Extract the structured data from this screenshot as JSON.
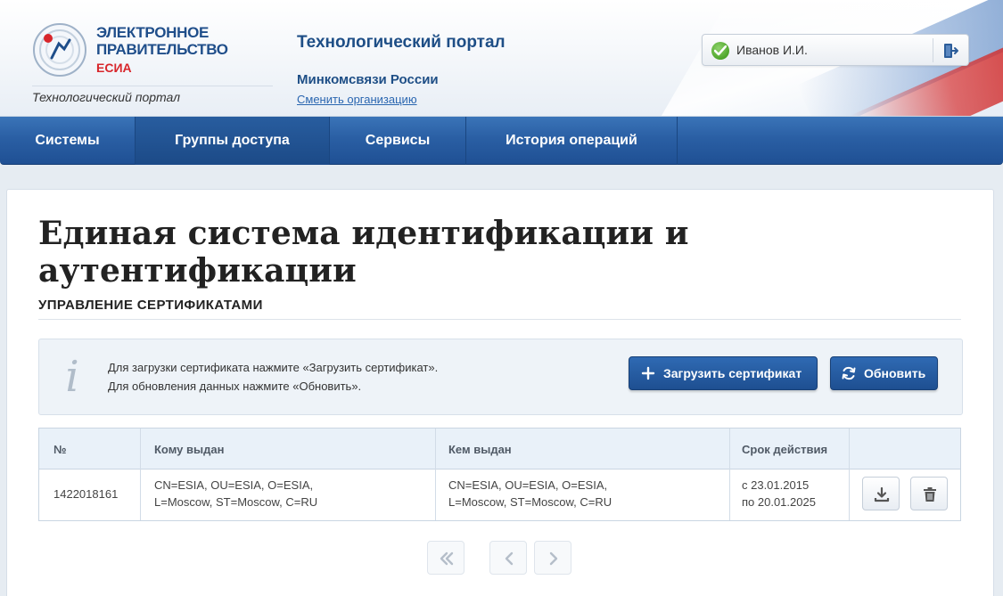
{
  "header": {
    "logo": {
      "line1": "ЭЛЕКТРОННОЕ",
      "line2": "ПРАВИТЕЛЬСТВО",
      "line3": "ЕСИА",
      "subtitle": "Технологический портал"
    },
    "portal_title": "Технологический портал",
    "organization": "Минкомсвязи России",
    "change_org_link": "Сменить организацию",
    "user": {
      "name": "Иванов И.И.",
      "status_icon": "check-icon",
      "logout_icon": "logout-icon"
    }
  },
  "nav": {
    "items": [
      {
        "label": "Системы",
        "active": false
      },
      {
        "label": "Группы доступа",
        "active": true
      },
      {
        "label": "Сервисы",
        "active": false
      },
      {
        "label": "История операций",
        "active": false
      }
    ]
  },
  "main": {
    "title": "Единая система идентификации и аутентификации",
    "section_title": "УПРАВЛЕНИЕ СЕРТИФИКАТАМИ",
    "info": {
      "icon": "info-icon",
      "line1": "Для загрузки сертификата нажмите «Загрузить сертификат».",
      "line2": "Для обновления данных нажмите «Обновить»."
    },
    "buttons": {
      "upload": "Загрузить сертификат",
      "refresh": "Обновить"
    },
    "table": {
      "headers": [
        "№",
        "Кому выдан",
        "Кем выдан",
        "Срок действия",
        ""
      ],
      "rows": [
        {
          "number": "1422018161",
          "issued_to_1": "CN=ESIA, OU=ESIA, O=ESIA,",
          "issued_to_2": "L=Moscow, ST=Moscow, C=RU",
          "issued_by_1": "CN=ESIA, OU=ESIA, O=ESIA,",
          "issued_by_2": "L=Moscow, ST=Moscow, C=RU",
          "valid_from": "с 23.01.2015",
          "valid_to": "по 20.01.2025"
        }
      ]
    },
    "pagination": {
      "first_icon": "double-chevron-left-icon",
      "prev_icon": "chevron-left-icon",
      "next_icon": "chevron-right-icon"
    }
  },
  "colors": {
    "brand_blue": "#1f5094",
    "brand_red": "#d8262b",
    "title_blue": "#1e4e86",
    "link_blue": "#2a66b0"
  }
}
